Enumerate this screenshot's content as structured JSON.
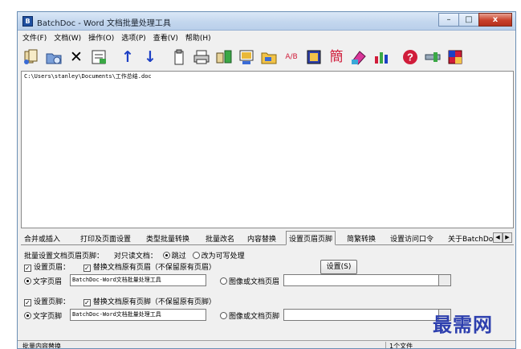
{
  "window": {
    "title": "BatchDoc - Word 文档批量处理工具",
    "app_icon_letter": "B",
    "controls": {
      "minimize": "–",
      "maximize": "□",
      "close": "x"
    }
  },
  "menu": [
    "文件(F)",
    "文档(W)",
    "操作(O)",
    "选项(P)",
    "查看(V)",
    "帮助(H)"
  ],
  "toolbar": {
    "icons": [
      "add-files-icon",
      "add-folder-icon",
      "delete-icon",
      "clear-list-icon",
      "move-up-icon",
      "move-down-icon",
      "paste-icon",
      "print-icon",
      "batch-replace-icon",
      "convert-icon",
      "folder-icon",
      "spell-icon",
      "page-setup-icon",
      "simplified-chinese-icon",
      "tools-icon",
      "statistics-icon",
      "help-icon",
      "settings-icon",
      "exit-icon"
    ],
    "glyphs": {
      "delete": "✕",
      "up": "↑",
      "down": "↓",
      "jian": "簡",
      "help": "?",
      "ab": "A/B"
    },
    "accent_blue": "#1c3fc4",
    "accent_red": "#d01c3a"
  },
  "document": {
    "path": "C:\\Users\\stanley\\Documents\\工作总结.doc"
  },
  "tabs": [
    "合并或插入",
    "打印及页面设置",
    "类型批量转换",
    "批量改名",
    "内容替换",
    "设置页眉页脚",
    "简繁转换",
    "设置访问口令",
    "关于BatchDoc"
  ],
  "active_tab": "设置页眉页脚",
  "panel": {
    "heading": "批量设置文档页眉页脚：",
    "readonly_label": "对只读文档：",
    "skip_option": "跳过",
    "writable_option": "改为可写处理",
    "settings_button": "设置(S)",
    "header": {
      "enable_label": "设置页眉：",
      "replace_label": "替换文档原有页眉（不保留原有页眉）",
      "text_option": "文字页眉",
      "text_value": "BatchDoc-Word文档批量处理工具",
      "image_option": "图像或文档页眉",
      "image_value": ""
    },
    "footer": {
      "enable_label": "设置页脚：",
      "replace_label": "替换文档原有页脚（不保留原有页脚）",
      "text_option": "文字页脚",
      "text_value": "BatchDoc-Word文档批量处理工具",
      "image_option": "图像或文档页脚",
      "image_value": ""
    }
  },
  "status": {
    "left": "批量内容替换",
    "right": "1个文件"
  },
  "watermark": "最需网"
}
